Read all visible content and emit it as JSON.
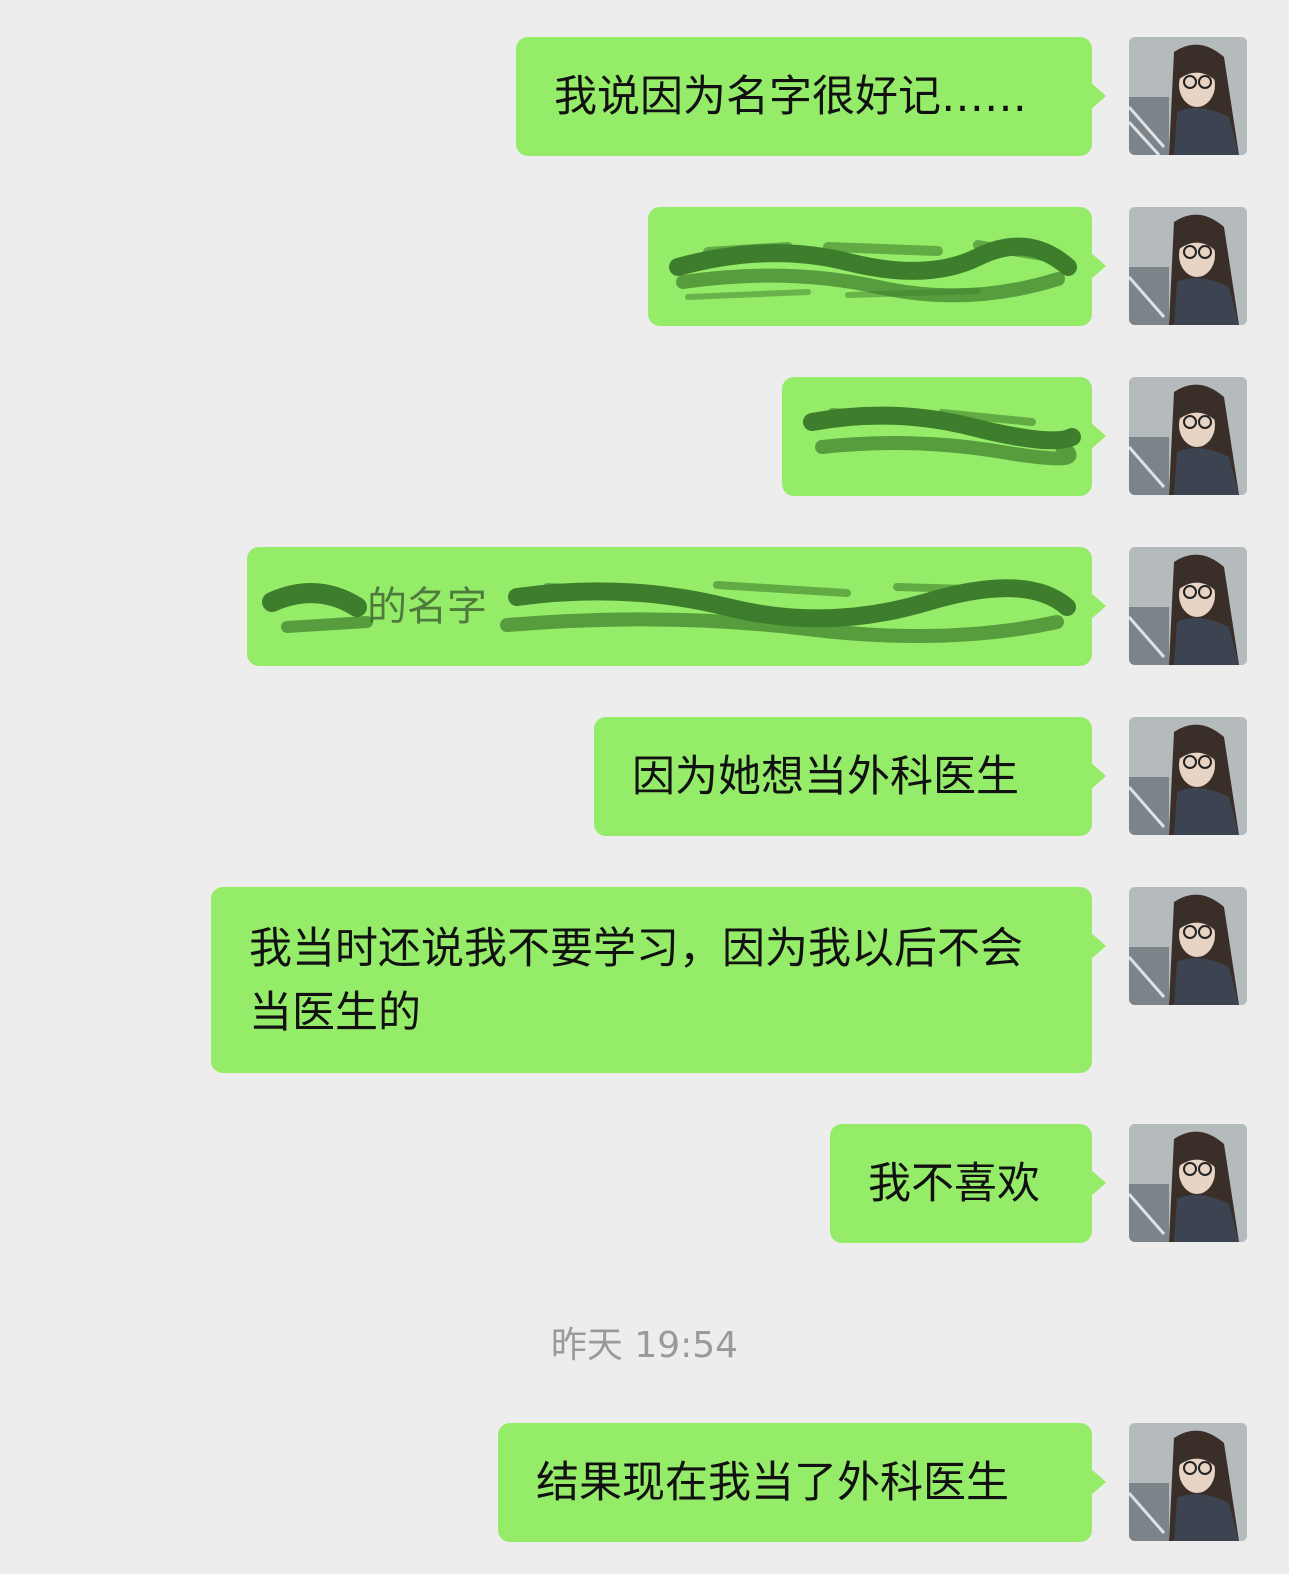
{
  "chat": {
    "messages": [
      {
        "text": "我说因为名字很好记……"
      },
      {
        "text": "",
        "redacted": true
      },
      {
        "text": "",
        "redacted": true
      },
      {
        "text": "",
        "redacted": true,
        "partial_visible": "的名字"
      },
      {
        "text": "因为她想当外科医生"
      },
      {
        "text": "我当时还说我不要学习，因为我以后不会当医生的"
      },
      {
        "text": "我不喜欢"
      },
      {
        "text": "结果现在我当了外科医生"
      }
    ],
    "timestamp": "昨天 19:54"
  },
  "colors": {
    "background": "#ededed",
    "bubble": "#95ec69",
    "scribble": "#2e6a22",
    "timestamp": "#9a9a9a"
  },
  "icons": {
    "avatar": "self-avatar-photo"
  }
}
